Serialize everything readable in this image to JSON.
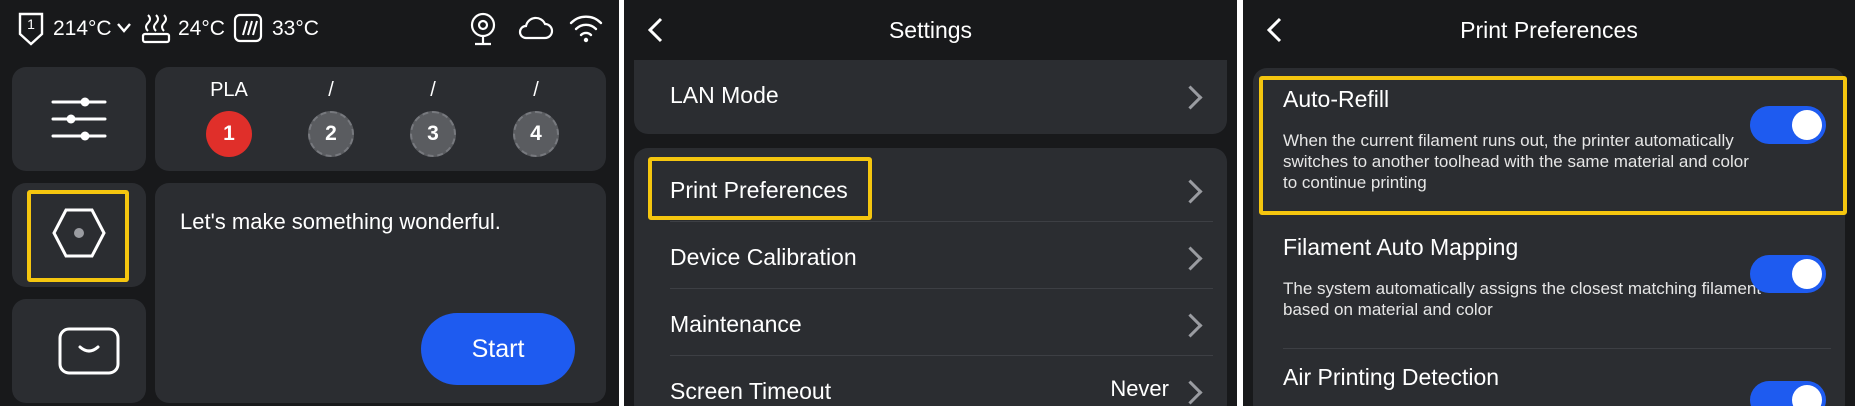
{
  "status_bar": {
    "nozzle_number": "1",
    "nozzle_temp": "214°C",
    "bed_temp": "24°C",
    "chamber_temp": "33°C"
  },
  "home": {
    "filament_slots": [
      {
        "label": "PLA",
        "number": "1",
        "color": "#e02f2a"
      },
      {
        "label": "/",
        "number": "2",
        "color": "#5a5c60"
      },
      {
        "label": "/",
        "number": "3",
        "color": "#5a5c60"
      },
      {
        "label": "/",
        "number": "4",
        "color": "#5a5c60"
      }
    ],
    "welcome_text": "Let's make something wonderful.",
    "start_label": "Start"
  },
  "settings": {
    "title": "Settings",
    "lan_mode_label": "LAN Mode",
    "items": [
      {
        "label": "Print Preferences",
        "value": ""
      },
      {
        "label": "Device Calibration",
        "value": ""
      },
      {
        "label": "Maintenance",
        "value": ""
      },
      {
        "label": "Screen Timeout",
        "value": "Never"
      }
    ]
  },
  "print_preferences": {
    "title": "Print Preferences",
    "options": [
      {
        "title": "Auto-Refill",
        "description": "When the current filament runs out, the printer automatically switches to another toolhead with the same material and color to continue printing",
        "enabled": true
      },
      {
        "title": "Filament Auto Mapping",
        "description": "The system automatically assigns the closest matching filament based on material and color",
        "enabled": true
      },
      {
        "title": "Air Printing Detection",
        "description": "",
        "enabled": true
      }
    ]
  },
  "colors": {
    "background": "#18191b",
    "card": "#2b2d31",
    "accent_blue": "#1e5bf0",
    "highlight": "#f5c60f",
    "active_slot": "#e02f2a"
  }
}
